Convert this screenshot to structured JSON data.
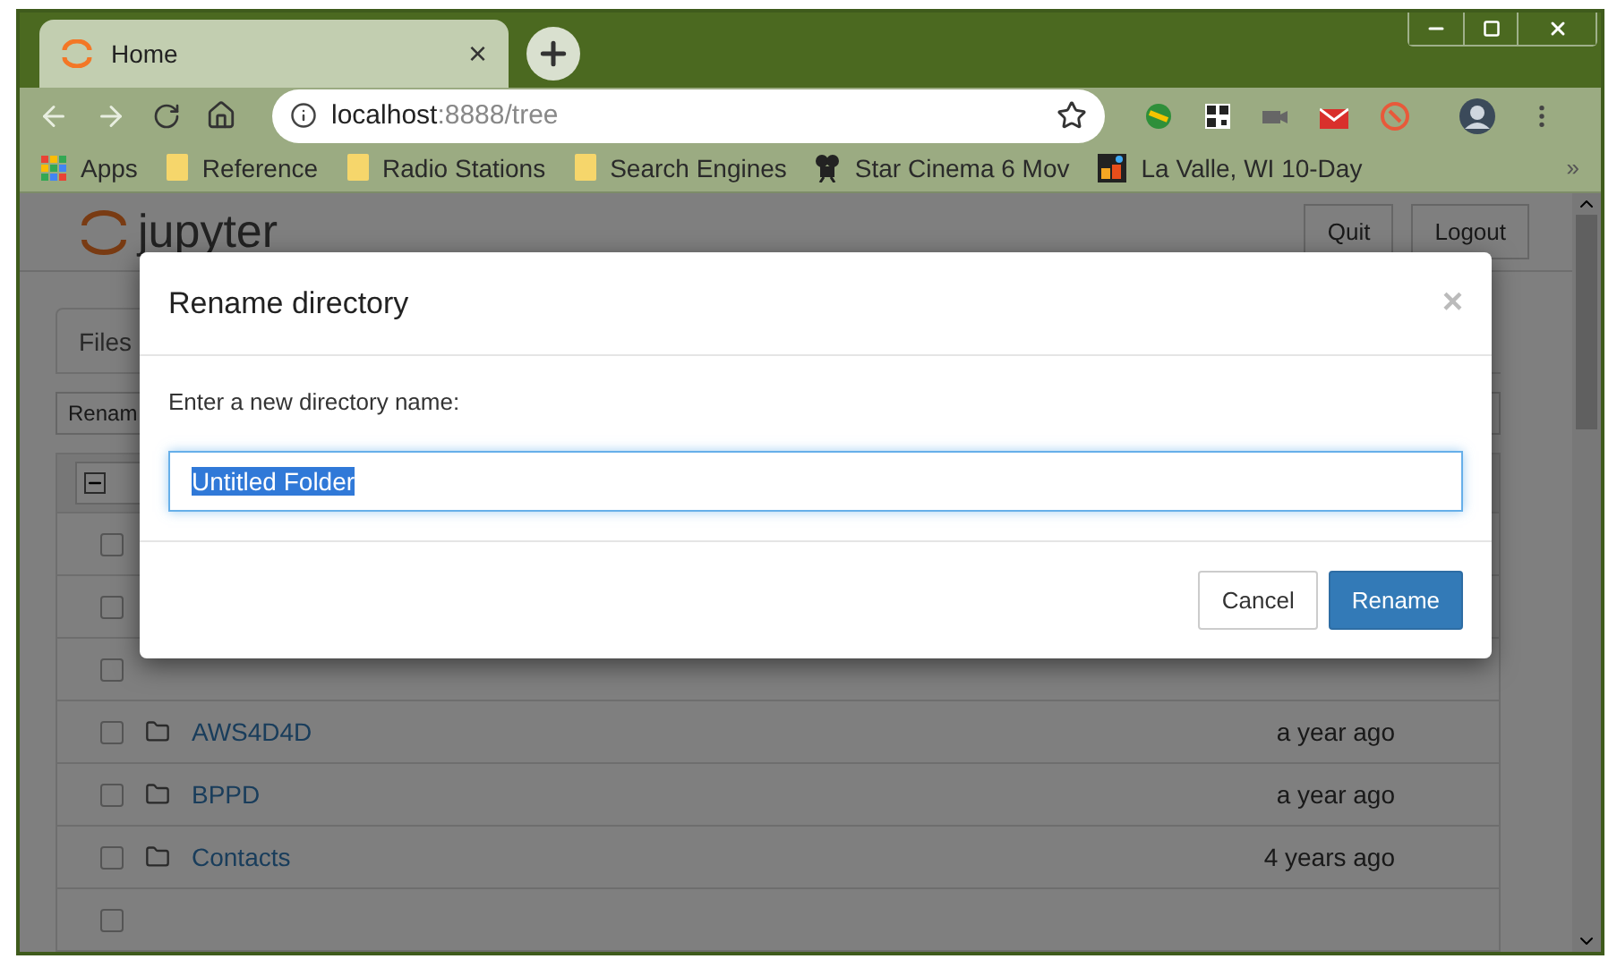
{
  "browser": {
    "tab": {
      "title": "Home",
      "close": "×"
    },
    "address": {
      "host": "localhost",
      "path": ":8888/tree"
    },
    "bookmarks": [
      {
        "label": "Apps",
        "kind": "apps"
      },
      {
        "label": "Reference",
        "kind": "folder"
      },
      {
        "label": "Radio Stations",
        "kind": "folder"
      },
      {
        "label": "Search Engines",
        "kind": "folder"
      },
      {
        "label": "Star Cinema 6 Mov",
        "kind": "film"
      },
      {
        "label": "La Valle, WI 10-Day",
        "kind": "weather"
      }
    ],
    "more": "»"
  },
  "page": {
    "logo": "jupyter",
    "header_buttons": [
      "Quit",
      "Logout"
    ],
    "tab": "Files",
    "action": "Renam",
    "rows": [
      {
        "kind": "covered",
        "checked": false
      },
      {
        "kind": "covered",
        "checked": false
      },
      {
        "kind": "covered",
        "checked": false
      },
      {
        "kind": "folder",
        "name": "AWS4D4D",
        "modified": "a year ago",
        "checked": false
      },
      {
        "kind": "folder",
        "name": "BPPD",
        "modified": "a year ago",
        "checked": false
      },
      {
        "kind": "folder",
        "name": "Contacts",
        "modified": "4 years ago",
        "checked": false
      },
      {
        "kind": "covered",
        "checked": false
      }
    ]
  },
  "dialog": {
    "title": "Rename directory",
    "close": "×",
    "prompt": "Enter a new directory name:",
    "input": {
      "value": "Untitled Folder",
      "selected": true
    },
    "buttons": [
      {
        "label": "Cancel",
        "kind": "default"
      },
      {
        "label": "Rename",
        "kind": "primary"
      }
    ]
  }
}
